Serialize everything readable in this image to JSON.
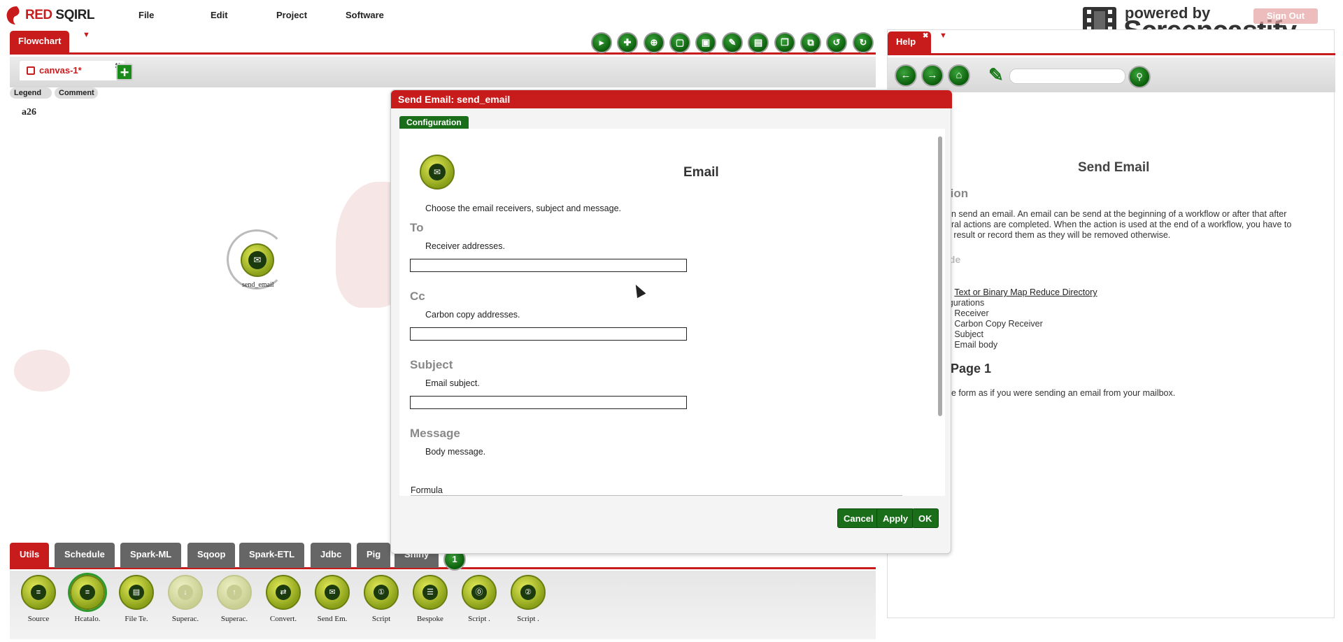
{
  "app": {
    "logo_red": "RED",
    "logo_dark": " SQIRL",
    "menu": [
      "File",
      "Edit",
      "Project",
      "Software"
    ],
    "sign_out": "Sign Out"
  },
  "overlay": {
    "powered_by": "powered by",
    "brand": "Screencastify Lite"
  },
  "flowchart": {
    "tab_label": "Flowchart",
    "toolbar_icons": [
      "run-icon",
      "publish-icon",
      "target-icon",
      "open-icon",
      "save-icon",
      "edit-icon",
      "saveas-icon",
      "windows-icon",
      "copy-icon",
      "undo-icon",
      "redo-icon"
    ],
    "canvas_tab": "canvas-1*",
    "add_canvas": "+",
    "legend_btn": "Legend",
    "comment_btn": "Comment",
    "canvas_label": "a26",
    "node_label": "send_email"
  },
  "palette": {
    "tabs": [
      "Utils",
      "Schedule",
      "Spark-ML",
      "Sqoop",
      "Spark-ETL",
      "Jdbc",
      "Pig",
      "Shiny"
    ],
    "active_tab": "Utils",
    "badge": "1",
    "items": [
      {
        "label": "Source",
        "icon": "database-icon"
      },
      {
        "label": "Hcatalo.",
        "icon": "database-icon"
      },
      {
        "label": "File Te.",
        "icon": "file-icon"
      },
      {
        "label": "Superac.",
        "icon": "download-icon"
      },
      {
        "label": "Superac.",
        "icon": "upload-icon"
      },
      {
        "label": "Convert.",
        "icon": "convert-icon"
      },
      {
        "label": "Send Em.",
        "icon": "email-icon"
      },
      {
        "label": "Script",
        "icon": "script-icon"
      },
      {
        "label": "Bespoke",
        "icon": "list-icon"
      },
      {
        "label": "Script .",
        "icon": "script-icon"
      },
      {
        "label": "Script .",
        "icon": "script-icon"
      }
    ]
  },
  "help": {
    "tab_label": "Help",
    "title": "Send Email",
    "section1": "tion",
    "para1_l1": "on send an email. An email can be send at the beginning of a workflow or after that after",
    "para1_l2": "eral actions are completed. When the action is used at the end of a workflow, you have to",
    "para1_l3": "u result or record them as they will be removed otherwise.",
    "section2": "ide",
    "link1": "Text or Binary Map Reduce Directory",
    "configs": "igurations",
    "list": [
      "Receiver",
      "Carbon Copy Receiver",
      "Subject",
      "Email body"
    ],
    "page_heading": "Page 1",
    "page_text": "he form as if you were sending an email from your mailbox."
  },
  "dialog": {
    "title": "Send Email: send_email",
    "config_tab": "Configuration",
    "heading": "Email",
    "intro": "Choose the email receivers, subject and message.",
    "fields": [
      {
        "label": "To",
        "desc": "Receiver addresses.",
        "value": ""
      },
      {
        "label": "Cc",
        "desc": "Carbon copy addresses.",
        "value": ""
      },
      {
        "label": "Subject",
        "desc": "Email subject.",
        "value": ""
      },
      {
        "label": "Message",
        "desc": "Body message.",
        "value": ""
      }
    ],
    "formula_label": "Formula",
    "buttons": {
      "cancel": "Cancel",
      "apply": "Apply",
      "ok": "OK"
    }
  },
  "colors": {
    "brand_red": "#c81b1b",
    "action_green": "#1a6e1a"
  }
}
